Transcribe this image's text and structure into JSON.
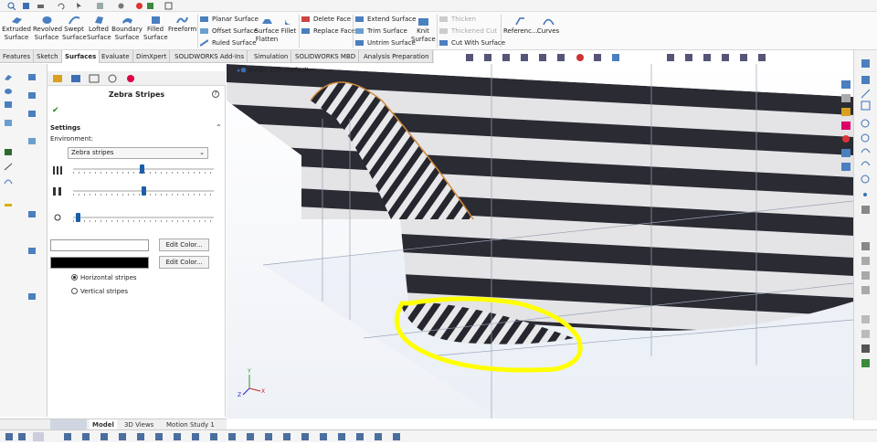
{
  "ribbon": {
    "big_buttons": [
      {
        "line1": "Extruded",
        "line2": "Surface",
        "icon": "extruded-surface-icon"
      },
      {
        "line1": "Revolved",
        "line2": "Surface",
        "icon": "revolved-surface-icon"
      },
      {
        "line1": "Swept",
        "line2": "Surface",
        "icon": "swept-surface-icon"
      },
      {
        "line1": "Lofted",
        "line2": "Surface",
        "icon": "lofted-surface-icon"
      },
      {
        "line1": "Boundary",
        "line2": "Surface",
        "icon": "boundary-surface-icon"
      },
      {
        "line1": "Filled",
        "line2": "Surface",
        "icon": "filled-surface-icon"
      },
      {
        "line1": "Freeform",
        "line2": "",
        "icon": "freeform-icon"
      }
    ],
    "col1": [
      "Planar Surface",
      "Offset Surface",
      "Ruled Surface"
    ],
    "flatten": {
      "line1": "Surface",
      "line2": "Flatten"
    },
    "fillet": "Fillet",
    "col2": [
      "Delete Face",
      "Replace Face"
    ],
    "col3": [
      "Extend Surface",
      "Trim Surface",
      "Untrim Surface"
    ],
    "knit": {
      "line1": "Knit",
      "line2": "Surface"
    },
    "col4": [
      "Thicken",
      "Thickened Cut",
      "Cut With Surface"
    ],
    "reference": "Referenc...",
    "curves": "Curves"
  },
  "tabs": [
    "Features",
    "Sketch",
    "Surfaces",
    "Evaluate",
    "DimXpert",
    "SOLIDWORKS Add-Ins",
    "Simulation",
    "SOLIDWORKS MBD",
    "Analysis Preparation"
  ],
  "active_tab": "Surfaces",
  "property_manager": {
    "title": "Zebra Stripes",
    "help": "?",
    "settings_label": "Settings",
    "environment_label": "Environment:",
    "environment_value": "Zebra stripes",
    "sliders": [
      {
        "name": "number-of-stripes",
        "value": 0.49
      },
      {
        "name": "stripe-width",
        "value": 0.5
      },
      {
        "name": "precision",
        "value": 0.02
      }
    ],
    "edit_color_1": "Edit Color...",
    "edit_color_2": "Edit Color...",
    "color_1": "#ffffff",
    "color_2": "#000000",
    "radio_horizontal": "Horizontal stripes",
    "radio_vertical": "Vertical stripes",
    "selected_orientation": "horizontal"
  },
  "document": {
    "title": "thesis v10 (Default<..."
  },
  "bottom_tabs": [
    "Model",
    "3D Views",
    "Motion Study 1"
  ],
  "active_bottom_tab": "Model",
  "colors": {
    "highlight": "#ffff00",
    "accent_blue": "#1b5fa8",
    "edge_orange": "#d08a3a"
  }
}
